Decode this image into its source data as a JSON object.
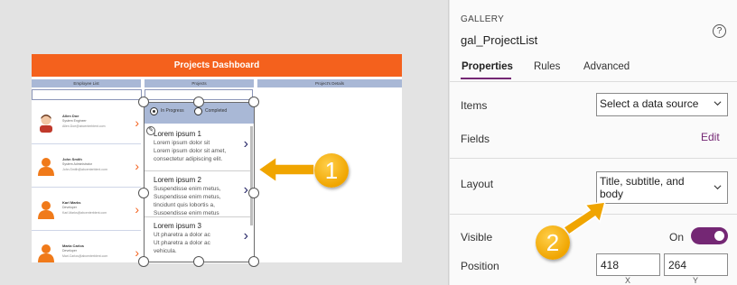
{
  "app": {
    "title": "Projects Dashboard",
    "columns": [
      "Employee List",
      "Projects",
      "Project's Details"
    ],
    "employees": [
      {
        "name": "Allen Doe",
        "role": "System Engineer",
        "email": "Allen.Doe@abcenterblent.com",
        "avatar": "male-avatar-icon"
      },
      {
        "name": "John Smith",
        "role": "System Administrator",
        "email": "John.Smith@abcenterblent.com",
        "avatar": "person-avatar-icon"
      },
      {
        "name": "Karl Marks",
        "role": "Developer",
        "email": "Karl.Marks@abcenterblent.com",
        "avatar": "person-avatar-icon"
      },
      {
        "name": "Maria Carlos",
        "role": "Developer",
        "email": "Mari.Carlos@abcenterblent.com",
        "avatar": "person-avatar-icon"
      }
    ],
    "filter": {
      "options": [
        "In Progress",
        "Completed"
      ],
      "selected": "In Progress"
    },
    "projects": [
      {
        "title": "Lorem ipsum 1",
        "lines": [
          "Lorem ipsum dolor sit",
          "Lorem ipsum dolor sit amet,",
          "consectetur adipiscing elit."
        ]
      },
      {
        "title": "Lorem ipsum 2",
        "lines": [
          "Suspendisse enim metus,",
          "Suspendisse enim metus,",
          "tincidunt quis lobortis a,",
          "Suspendisse enim metus"
        ]
      },
      {
        "title": "Lorem ipsum 3",
        "lines": [
          "Ut pharetra a dolor ac",
          "Ut pharetra a dolor ac",
          "vehicula."
        ]
      }
    ],
    "colors": {
      "header": "#f4611d",
      "column_header": "#a9b8d6",
      "accent": "#742774",
      "callout": "#f0a500"
    }
  },
  "callouts": [
    "1",
    "2"
  ],
  "pane": {
    "control_type": "GALLERY",
    "control_name": "gal_ProjectList",
    "help_icon": "question-mark-icon",
    "tabs": [
      "Properties",
      "Rules",
      "Advanced"
    ],
    "active_tab": "Properties",
    "items_label": "Items",
    "items_value": "Select a data source",
    "fields_label": "Fields",
    "fields_link": "Edit",
    "layout_label": "Layout",
    "layout_value": "Title, subtitle, and body",
    "visible_label": "Visible",
    "visible_state": "On",
    "visible_on": true,
    "position_label": "Position",
    "position_x": "418",
    "position_y": "264",
    "axis_x": "X",
    "axis_y": "Y"
  }
}
